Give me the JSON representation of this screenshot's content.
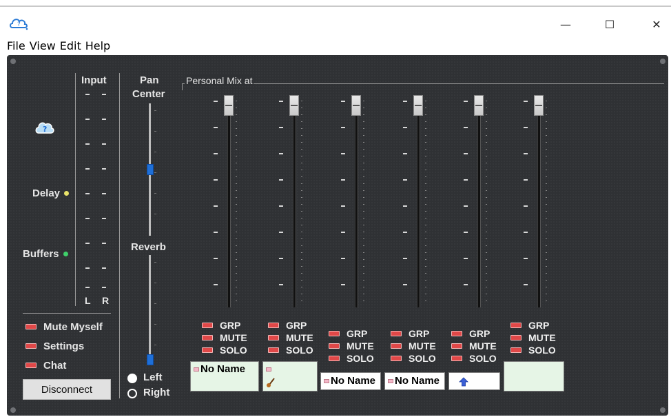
{
  "window": {
    "title_icon": "cloud-app-icon",
    "controls": {
      "minimize": "—",
      "maximize": "☐",
      "close": "✕"
    }
  },
  "menu": [
    "File",
    "View",
    "Edit",
    "Help"
  ],
  "left": {
    "input_label": "Input",
    "lr_left": "L",
    "lr_right": "R",
    "delay_label": "Delay",
    "buffers_label": "Buffers",
    "mute_myself": "Mute Myself",
    "settings": "Settings",
    "chat": "Chat",
    "disconnect": "Disconnect",
    "colors": {
      "delay_dot": "#e8e36a",
      "buffers_dot": "#3fd06a",
      "led": "#e04848"
    }
  },
  "pan": {
    "title_line1": "Pan",
    "title_line2": "Center",
    "reverb": "Reverb",
    "left": "Left",
    "right": "Right",
    "pan_value": 0.5,
    "reverb_value": 0.0,
    "selected_channel": "Left"
  },
  "mix": {
    "title": "Personal Mix at",
    "grp": "GRP",
    "mute": "MUTE",
    "solo": "SOLO",
    "channels": [
      {
        "name": "No Name",
        "has_flag": true,
        "icon": "",
        "bg": "#e6f5e6"
      },
      {
        "name": "",
        "has_flag": true,
        "icon": "guitar-icon",
        "bg": "#e6f5e6"
      },
      {
        "name": "No Name",
        "has_flag": true,
        "icon": "",
        "bg": "#ffffff"
      },
      {
        "name": "No Name",
        "has_flag": true,
        "icon": "",
        "bg": "#ffffff"
      },
      {
        "name": "",
        "has_flag": false,
        "icon": "up-arrow-icon",
        "bg": "#ffffff"
      },
      {
        "name": "",
        "has_flag": false,
        "icon": "",
        "bg": "#e6f5e6"
      }
    ]
  }
}
